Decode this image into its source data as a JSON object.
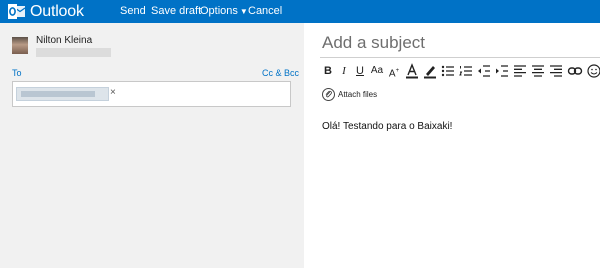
{
  "header": {
    "app_name": "Outlook",
    "commands": {
      "send": "Send",
      "save_draft": "Save draft",
      "options": "Options",
      "cancel": "Cancel"
    },
    "colors": {
      "brand": "#0072c6"
    }
  },
  "compose": {
    "sender_name": "Nilton Kleina",
    "to_label": "To",
    "cc_bcc_label": "Cc & Bcc",
    "recipient_remove_glyph": "×",
    "subject_placeholder": "Add a subject",
    "toolbar": [
      "bold-icon",
      "italic-icon",
      "underline-icon",
      "font-size-icon",
      "grow-font-icon",
      "font-color-icon",
      "highlight-icon",
      "bullet-list-icon",
      "numbered-list-icon",
      "decrease-indent-icon",
      "increase-indent-icon",
      "align-left-icon",
      "align-center-icon",
      "align-right-icon",
      "link-icon",
      "emoji-icon"
    ],
    "attach_label": "Attach files",
    "body_text": "Olá! Testando para o Baixaki!"
  }
}
